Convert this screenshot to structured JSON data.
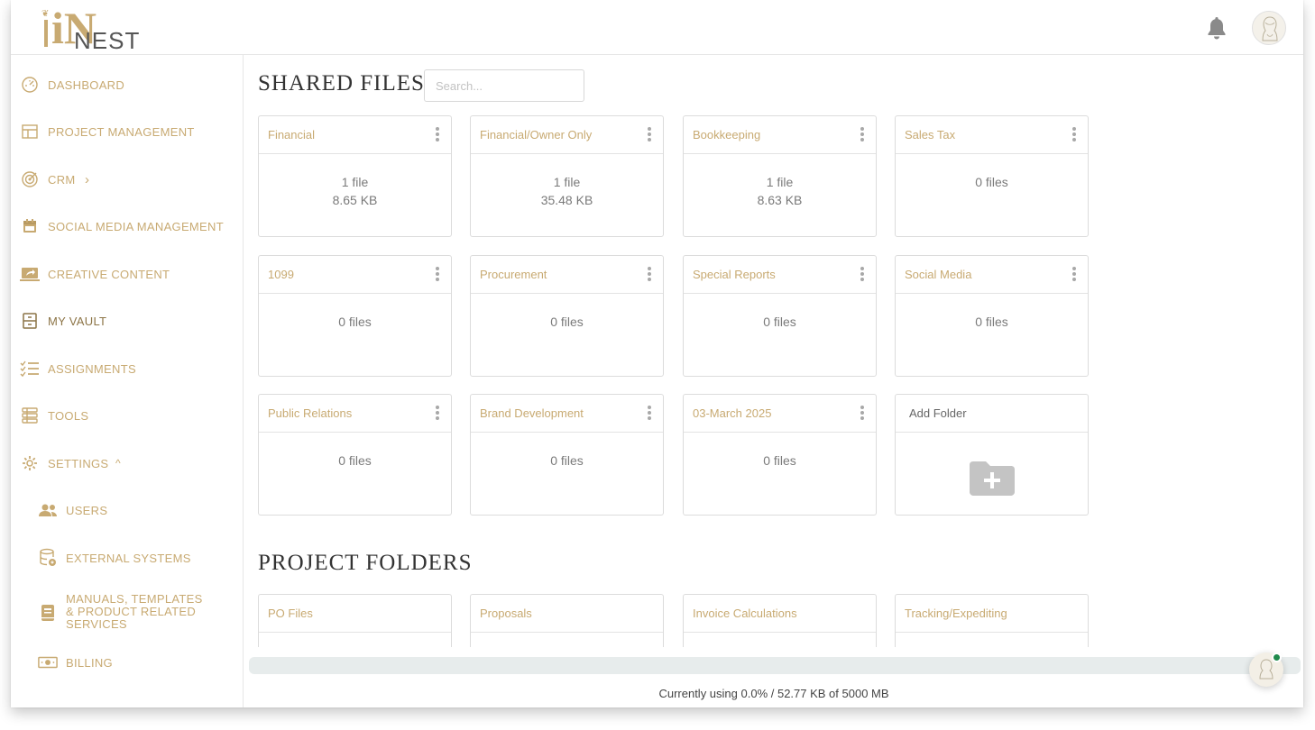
{
  "brand": {
    "logo_letters": "iN",
    "logo_word": "NEST",
    "accent": "#c8aa72"
  },
  "header": {
    "bell_icon": "bell-icon",
    "avatar_icon": "user-avatar"
  },
  "sidebar": {
    "items": [
      {
        "label": "DASHBOARD",
        "icon": "speedometer-icon"
      },
      {
        "label": "PROJECT MANAGEMENT",
        "icon": "table-icon"
      },
      {
        "label": "CRM",
        "icon": "target-icon",
        "chevron": "›"
      },
      {
        "label": "SOCIAL MEDIA MANAGEMENT",
        "icon": "calendar-icon"
      },
      {
        "label": "CREATIVE CONTENT",
        "icon": "share-screen-icon"
      },
      {
        "label": "MY VAULT",
        "icon": "vault-icon"
      },
      {
        "label": "ASSIGNMENTS",
        "icon": "checklist-icon"
      },
      {
        "label": "TOOLS",
        "icon": "tools-icon"
      },
      {
        "label": "SETTINGS",
        "icon": "gear-icon",
        "chevron": "^"
      },
      {
        "label": "USERS",
        "icon": "users-icon"
      },
      {
        "label": "EXTERNAL SYSTEMS",
        "icon": "database-icon"
      },
      {
        "label_lines": [
          "MANUALS, TEMPLATES",
          "& PRODUCT RELATED",
          "SERVICES"
        ],
        "icon": "book-icon"
      },
      {
        "label": "BILLING",
        "icon": "money-icon"
      }
    ]
  },
  "shared": {
    "title": "SHARED FILES",
    "search_placeholder": "Search...",
    "folders": [
      {
        "name": "Financial",
        "count": "1 file",
        "size": "8.65 KB"
      },
      {
        "name": "Financial/Owner Only",
        "count": "1 file",
        "size": "35.48 KB"
      },
      {
        "name": "Bookkeeping",
        "count": "1 file",
        "size": "8.63 KB"
      },
      {
        "name": "Sales Tax",
        "count": "0 files",
        "size": ""
      },
      {
        "name": "1099",
        "count": "0 files",
        "size": ""
      },
      {
        "name": "Procurement",
        "count": "0 files",
        "size": ""
      },
      {
        "name": "Special Reports",
        "count": "0 files",
        "size": ""
      },
      {
        "name": "Social Media",
        "count": "0 files",
        "size": ""
      },
      {
        "name": "Public Relations",
        "count": "0 files",
        "size": ""
      },
      {
        "name": "Brand Development",
        "count": "0 files",
        "size": ""
      },
      {
        "name": "03-March 2025",
        "count": "0 files",
        "size": ""
      }
    ],
    "add_folder_label": "Add Folder"
  },
  "project": {
    "title": "PROJECT FOLDERS",
    "folders": [
      {
        "name": "PO Files"
      },
      {
        "name": "Proposals"
      },
      {
        "name": "Invoice Calculations"
      },
      {
        "name": "Tracking/Expediting"
      }
    ]
  },
  "usage": {
    "text": "Currently using 0.0% / 52.77 KB of 5000 MB",
    "percent": 0.0
  }
}
